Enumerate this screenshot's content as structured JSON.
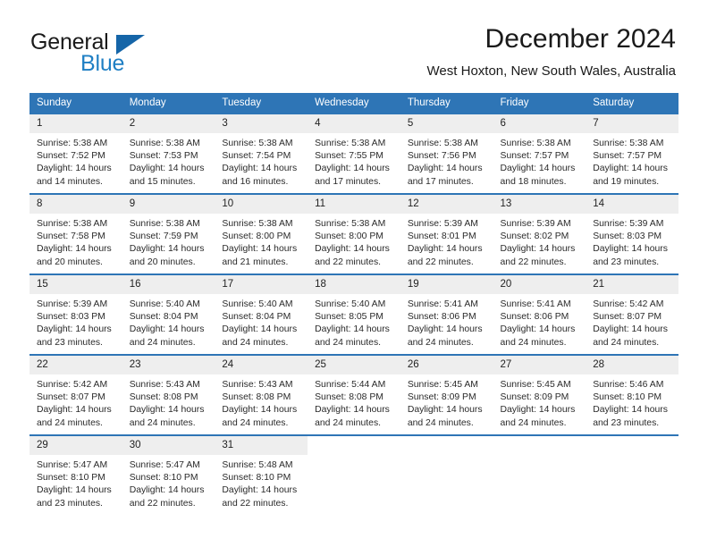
{
  "brand": {
    "name_part1": "General",
    "name_part2": "Blue",
    "triangle_color": "#1565a8",
    "blue_color": "#1f7fc4"
  },
  "header": {
    "month_title": "December 2024",
    "location": "West Hoxton, New South Wales, Australia"
  },
  "theme": {
    "header_blue": "#2e75b6",
    "daynum_gray": "#eeeeee"
  },
  "weekday_headers": [
    "Sunday",
    "Monday",
    "Tuesday",
    "Wednesday",
    "Thursday",
    "Friday",
    "Saturday"
  ],
  "weeks": [
    [
      {
        "day": "1",
        "sunrise": "Sunrise: 5:38 AM",
        "sunset": "Sunset: 7:52 PM",
        "daylight_line1": "Daylight: 14 hours",
        "daylight_line2": "and 14 minutes."
      },
      {
        "day": "2",
        "sunrise": "Sunrise: 5:38 AM",
        "sunset": "Sunset: 7:53 PM",
        "daylight_line1": "Daylight: 14 hours",
        "daylight_line2": "and 15 minutes."
      },
      {
        "day": "3",
        "sunrise": "Sunrise: 5:38 AM",
        "sunset": "Sunset: 7:54 PM",
        "daylight_line1": "Daylight: 14 hours",
        "daylight_line2": "and 16 minutes."
      },
      {
        "day": "4",
        "sunrise": "Sunrise: 5:38 AM",
        "sunset": "Sunset: 7:55 PM",
        "daylight_line1": "Daylight: 14 hours",
        "daylight_line2": "and 17 minutes."
      },
      {
        "day": "5",
        "sunrise": "Sunrise: 5:38 AM",
        "sunset": "Sunset: 7:56 PM",
        "daylight_line1": "Daylight: 14 hours",
        "daylight_line2": "and 17 minutes."
      },
      {
        "day": "6",
        "sunrise": "Sunrise: 5:38 AM",
        "sunset": "Sunset: 7:57 PM",
        "daylight_line1": "Daylight: 14 hours",
        "daylight_line2": "and 18 minutes."
      },
      {
        "day": "7",
        "sunrise": "Sunrise: 5:38 AM",
        "sunset": "Sunset: 7:57 PM",
        "daylight_line1": "Daylight: 14 hours",
        "daylight_line2": "and 19 minutes."
      }
    ],
    [
      {
        "day": "8",
        "sunrise": "Sunrise: 5:38 AM",
        "sunset": "Sunset: 7:58 PM",
        "daylight_line1": "Daylight: 14 hours",
        "daylight_line2": "and 20 minutes."
      },
      {
        "day": "9",
        "sunrise": "Sunrise: 5:38 AM",
        "sunset": "Sunset: 7:59 PM",
        "daylight_line1": "Daylight: 14 hours",
        "daylight_line2": "and 20 minutes."
      },
      {
        "day": "10",
        "sunrise": "Sunrise: 5:38 AM",
        "sunset": "Sunset: 8:00 PM",
        "daylight_line1": "Daylight: 14 hours",
        "daylight_line2": "and 21 minutes."
      },
      {
        "day": "11",
        "sunrise": "Sunrise: 5:38 AM",
        "sunset": "Sunset: 8:00 PM",
        "daylight_line1": "Daylight: 14 hours",
        "daylight_line2": "and 22 minutes."
      },
      {
        "day": "12",
        "sunrise": "Sunrise: 5:39 AM",
        "sunset": "Sunset: 8:01 PM",
        "daylight_line1": "Daylight: 14 hours",
        "daylight_line2": "and 22 minutes."
      },
      {
        "day": "13",
        "sunrise": "Sunrise: 5:39 AM",
        "sunset": "Sunset: 8:02 PM",
        "daylight_line1": "Daylight: 14 hours",
        "daylight_line2": "and 22 minutes."
      },
      {
        "day": "14",
        "sunrise": "Sunrise: 5:39 AM",
        "sunset": "Sunset: 8:03 PM",
        "daylight_line1": "Daylight: 14 hours",
        "daylight_line2": "and 23 minutes."
      }
    ],
    [
      {
        "day": "15",
        "sunrise": "Sunrise: 5:39 AM",
        "sunset": "Sunset: 8:03 PM",
        "daylight_line1": "Daylight: 14 hours",
        "daylight_line2": "and 23 minutes."
      },
      {
        "day": "16",
        "sunrise": "Sunrise: 5:40 AM",
        "sunset": "Sunset: 8:04 PM",
        "daylight_line1": "Daylight: 14 hours",
        "daylight_line2": "and 24 minutes."
      },
      {
        "day": "17",
        "sunrise": "Sunrise: 5:40 AM",
        "sunset": "Sunset: 8:04 PM",
        "daylight_line1": "Daylight: 14 hours",
        "daylight_line2": "and 24 minutes."
      },
      {
        "day": "18",
        "sunrise": "Sunrise: 5:40 AM",
        "sunset": "Sunset: 8:05 PM",
        "daylight_line1": "Daylight: 14 hours",
        "daylight_line2": "and 24 minutes."
      },
      {
        "day": "19",
        "sunrise": "Sunrise: 5:41 AM",
        "sunset": "Sunset: 8:06 PM",
        "daylight_line1": "Daylight: 14 hours",
        "daylight_line2": "and 24 minutes."
      },
      {
        "day": "20",
        "sunrise": "Sunrise: 5:41 AM",
        "sunset": "Sunset: 8:06 PM",
        "daylight_line1": "Daylight: 14 hours",
        "daylight_line2": "and 24 minutes."
      },
      {
        "day": "21",
        "sunrise": "Sunrise: 5:42 AM",
        "sunset": "Sunset: 8:07 PM",
        "daylight_line1": "Daylight: 14 hours",
        "daylight_line2": "and 24 minutes."
      }
    ],
    [
      {
        "day": "22",
        "sunrise": "Sunrise: 5:42 AM",
        "sunset": "Sunset: 8:07 PM",
        "daylight_line1": "Daylight: 14 hours",
        "daylight_line2": "and 24 minutes."
      },
      {
        "day": "23",
        "sunrise": "Sunrise: 5:43 AM",
        "sunset": "Sunset: 8:08 PM",
        "daylight_line1": "Daylight: 14 hours",
        "daylight_line2": "and 24 minutes."
      },
      {
        "day": "24",
        "sunrise": "Sunrise: 5:43 AM",
        "sunset": "Sunset: 8:08 PM",
        "daylight_line1": "Daylight: 14 hours",
        "daylight_line2": "and 24 minutes."
      },
      {
        "day": "25",
        "sunrise": "Sunrise: 5:44 AM",
        "sunset": "Sunset: 8:08 PM",
        "daylight_line1": "Daylight: 14 hours",
        "daylight_line2": "and 24 minutes."
      },
      {
        "day": "26",
        "sunrise": "Sunrise: 5:45 AM",
        "sunset": "Sunset: 8:09 PM",
        "daylight_line1": "Daylight: 14 hours",
        "daylight_line2": "and 24 minutes."
      },
      {
        "day": "27",
        "sunrise": "Sunrise: 5:45 AM",
        "sunset": "Sunset: 8:09 PM",
        "daylight_line1": "Daylight: 14 hours",
        "daylight_line2": "and 24 minutes."
      },
      {
        "day": "28",
        "sunrise": "Sunrise: 5:46 AM",
        "sunset": "Sunset: 8:10 PM",
        "daylight_line1": "Daylight: 14 hours",
        "daylight_line2": "and 23 minutes."
      }
    ],
    [
      {
        "day": "29",
        "sunrise": "Sunrise: 5:47 AM",
        "sunset": "Sunset: 8:10 PM",
        "daylight_line1": "Daylight: 14 hours",
        "daylight_line2": "and 23 minutes."
      },
      {
        "day": "30",
        "sunrise": "Sunrise: 5:47 AM",
        "sunset": "Sunset: 8:10 PM",
        "daylight_line1": "Daylight: 14 hours",
        "daylight_line2": "and 22 minutes."
      },
      {
        "day": "31",
        "sunrise": "Sunrise: 5:48 AM",
        "sunset": "Sunset: 8:10 PM",
        "daylight_line1": "Daylight: 14 hours",
        "daylight_line2": "and 22 minutes."
      },
      {
        "day": "",
        "sunrise": "",
        "sunset": "",
        "daylight_line1": "",
        "daylight_line2": ""
      },
      {
        "day": "",
        "sunrise": "",
        "sunset": "",
        "daylight_line1": "",
        "daylight_line2": ""
      },
      {
        "day": "",
        "sunrise": "",
        "sunset": "",
        "daylight_line1": "",
        "daylight_line2": ""
      },
      {
        "day": "",
        "sunrise": "",
        "sunset": "",
        "daylight_line1": "",
        "daylight_line2": ""
      }
    ]
  ]
}
